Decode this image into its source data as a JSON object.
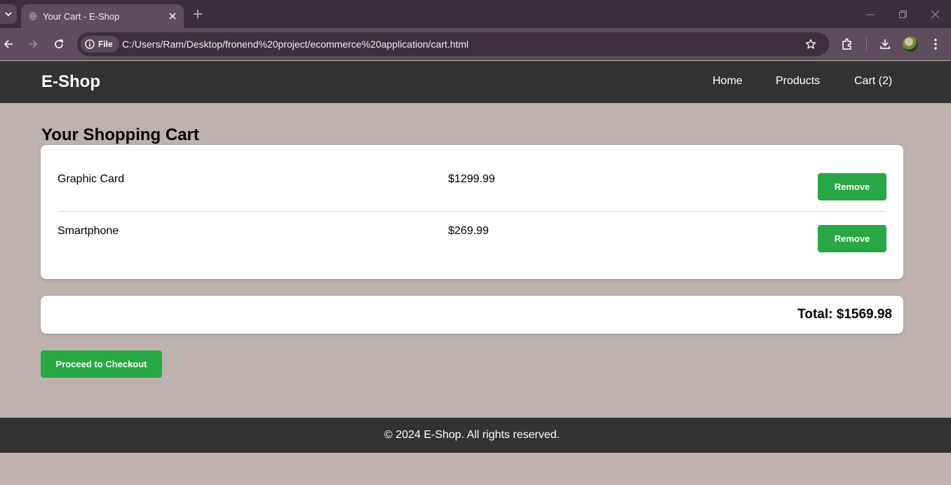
{
  "browser": {
    "tab_title": "Your Cart - E-Shop",
    "site_chip_label": "File",
    "url": "C:/Users/Ram/Desktop/fronend%20project/ecommerce%20application/cart.html"
  },
  "header": {
    "logo": "E-Shop",
    "nav": [
      {
        "label": "Home"
      },
      {
        "label": "Products"
      },
      {
        "label": "Cart (2)"
      }
    ]
  },
  "main": {
    "title": "Your Shopping Cart",
    "cart_items": [
      {
        "name": "Graphic Card",
        "price": "$1299.99",
        "action": "Remove"
      },
      {
        "name": "Smartphone",
        "price": "$269.99",
        "action": "Remove"
      }
    ],
    "total_label": "Total: $1569.98",
    "checkout_label": "Proceed to Checkout"
  },
  "footer": {
    "text": "© 2024 E-Shop. All rights reserved."
  },
  "colors": {
    "page_background": "#bdb2b0",
    "header_background": "#333333",
    "accent_green": "#28a745",
    "browser_tabstrip": "#3c2f3c",
    "browser_toolbar": "#5e4d5c"
  }
}
